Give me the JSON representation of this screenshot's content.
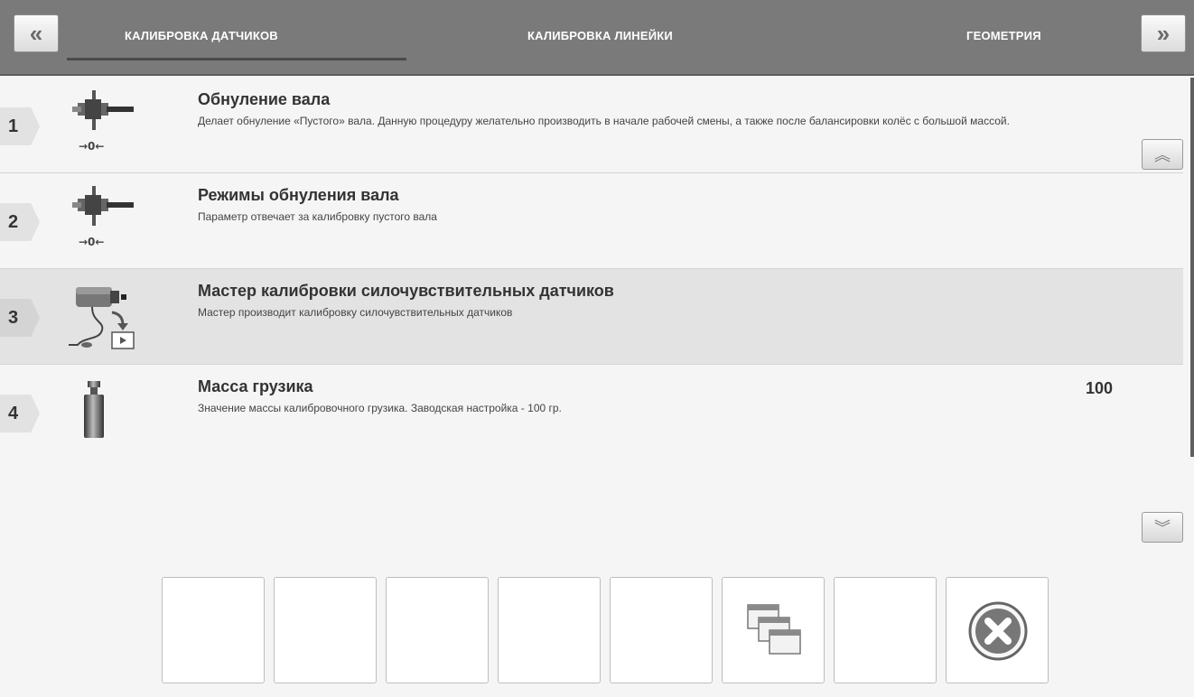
{
  "header": {
    "nav_left_label": "«",
    "nav_right_label": "»",
    "tabs": [
      {
        "label": "КАЛИБРОВКА ДАТЧИКОВ",
        "active": true
      },
      {
        "label": "КАЛИБРОВКА ЛИНЕЙКИ",
        "active": false
      },
      {
        "label": "ГЕОМЕТРИЯ",
        "active": false
      }
    ]
  },
  "items": [
    {
      "number": "1",
      "icon": "shaft-zero-icon",
      "icon_caption": "→0←",
      "title": "Обнуление вала",
      "description": "Делает обнуление «Пустого» вала. Данную процедуру желательно производить в начале рабочей смены, а также после балансировки колёс с большой массой.",
      "value": ""
    },
    {
      "number": "2",
      "icon": "shaft-zero-icon",
      "icon_caption": "→0←",
      "title": "Режимы обнуления вала",
      "description": "Параметр отвечает за калибровку пустого вала",
      "value": ""
    },
    {
      "number": "3",
      "icon": "sensor-wizard-icon",
      "title": "Мастер калибровки силочувствительных датчиков",
      "description": "Мастер производит калибровку силочувствительных датчиков",
      "value": ""
    },
    {
      "number": "4",
      "icon": "weight-icon",
      "title": "Масса грузика",
      "description": "Значение массы калибровочного грузика. Заводская настройка - 100 гр.",
      "value": "100"
    }
  ],
  "scroll": {
    "up_label": "︽",
    "down_label": "︾"
  },
  "footer": {
    "buttons": [
      {
        "icon": "none"
      },
      {
        "icon": "none"
      },
      {
        "icon": "none"
      },
      {
        "icon": "none"
      },
      {
        "icon": "none"
      },
      {
        "icon": "windows-icon"
      },
      {
        "icon": "none"
      },
      {
        "icon": "close-icon"
      }
    ]
  },
  "colors": {
    "header_bg": "#7a7a7a",
    "active_row": "#e3e3e3",
    "background": "#f5f5f5"
  }
}
